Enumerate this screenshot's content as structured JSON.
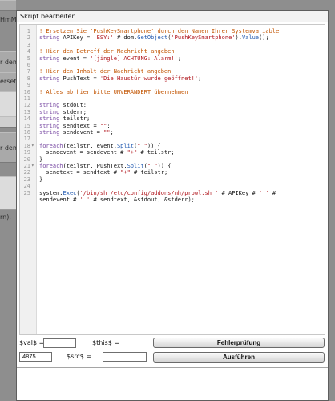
{
  "background": {
    "labels": [
      "HmM",
      "r dem",
      "ersetz",
      "r dem",
      "rn)."
    ]
  },
  "dialog": {
    "title": "Skript bearbeiten"
  },
  "editor": {
    "lines": [
      {
        "n": "1",
        "fold": "",
        "tokens": [
          {
            "t": "! Ersetzen Sie 'PushKeySmartphone' durch den Namen Ihrer Systemvariable",
            "c": "comment"
          }
        ]
      },
      {
        "n": "2",
        "fold": "",
        "tokens": [
          {
            "t": "string",
            "c": "keyword"
          },
          {
            "t": " APIKey = ",
            "c": "plain"
          },
          {
            "t": "'ESY:'",
            "c": "string"
          },
          {
            "t": " # dom.",
            "c": "plain"
          },
          {
            "t": "GetObject",
            "c": "func"
          },
          {
            "t": "(",
            "c": "plain"
          },
          {
            "t": "'PushKeySmartphone'",
            "c": "string"
          },
          {
            "t": ").",
            "c": "plain"
          },
          {
            "t": "Value",
            "c": "func"
          },
          {
            "t": "();",
            "c": "plain"
          }
        ]
      },
      {
        "n": "3",
        "fold": "",
        "tokens": []
      },
      {
        "n": "4",
        "fold": "",
        "tokens": [
          {
            "t": "! Hier den Betreff der Nachricht angeben",
            "c": "comment"
          }
        ]
      },
      {
        "n": "5",
        "fold": "",
        "tokens": [
          {
            "t": "string",
            "c": "keyword"
          },
          {
            "t": " event = ",
            "c": "plain"
          },
          {
            "t": "'[jingle] ACHTUNG: Alarm!'",
            "c": "string"
          },
          {
            "t": ";",
            "c": "plain"
          }
        ]
      },
      {
        "n": "6",
        "fold": "",
        "tokens": []
      },
      {
        "n": "7",
        "fold": "",
        "tokens": [
          {
            "t": "! Hier den Inhalt der Nachricht angeben",
            "c": "comment"
          }
        ]
      },
      {
        "n": "8",
        "fold": "",
        "tokens": [
          {
            "t": "string",
            "c": "keyword"
          },
          {
            "t": " PushText = ",
            "c": "plain"
          },
          {
            "t": "'Die Haustür wurde geöffnet!'",
            "c": "string"
          },
          {
            "t": ";",
            "c": "plain"
          }
        ]
      },
      {
        "n": "9",
        "fold": "",
        "tokens": []
      },
      {
        "n": "10",
        "fold": "",
        "tokens": [
          {
            "t": "! Alles ab hier bitte UNVERÄNDERT übernehmen",
            "c": "comment"
          }
        ]
      },
      {
        "n": "11",
        "fold": "",
        "tokens": []
      },
      {
        "n": "12",
        "fold": "",
        "tokens": [
          {
            "t": "string",
            "c": "keyword"
          },
          {
            "t": " stdout;",
            "c": "plain"
          }
        ]
      },
      {
        "n": "13",
        "fold": "",
        "tokens": [
          {
            "t": "string",
            "c": "keyword"
          },
          {
            "t": " stderr;",
            "c": "plain"
          }
        ]
      },
      {
        "n": "14",
        "fold": "",
        "tokens": [
          {
            "t": "string",
            "c": "keyword"
          },
          {
            "t": " teilstr;",
            "c": "plain"
          }
        ]
      },
      {
        "n": "15",
        "fold": "",
        "tokens": [
          {
            "t": "string",
            "c": "keyword"
          },
          {
            "t": " sendtext = ",
            "c": "plain"
          },
          {
            "t": "\"\"",
            "c": "string"
          },
          {
            "t": ";",
            "c": "plain"
          }
        ]
      },
      {
        "n": "16",
        "fold": "",
        "tokens": [
          {
            "t": "string",
            "c": "keyword"
          },
          {
            "t": " sendevent = ",
            "c": "plain"
          },
          {
            "t": "\"\"",
            "c": "string"
          },
          {
            "t": ";",
            "c": "plain"
          }
        ]
      },
      {
        "n": "17",
        "fold": "",
        "tokens": []
      },
      {
        "n": "18",
        "fold": "▾",
        "tokens": [
          {
            "t": "foreach",
            "c": "keyword"
          },
          {
            "t": "(teilstr, event.",
            "c": "plain"
          },
          {
            "t": "Split",
            "c": "func"
          },
          {
            "t": "(",
            "c": "plain"
          },
          {
            "t": "\" \"",
            "c": "string"
          },
          {
            "t": ")) {",
            "c": "plain"
          }
        ]
      },
      {
        "n": "19",
        "fold": "",
        "tokens": [
          {
            "t": "  sendevent = sendevent # ",
            "c": "plain"
          },
          {
            "t": "\"+\"",
            "c": "string"
          },
          {
            "t": " # teilstr;",
            "c": "plain"
          }
        ]
      },
      {
        "n": "20",
        "fold": "",
        "tokens": [
          {
            "t": "}",
            "c": "plain"
          }
        ]
      },
      {
        "n": "21",
        "fold": "▾",
        "tokens": [
          {
            "t": "foreach",
            "c": "keyword"
          },
          {
            "t": "(teilstr, PushText.",
            "c": "plain"
          },
          {
            "t": "Split",
            "c": "func"
          },
          {
            "t": "(",
            "c": "plain"
          },
          {
            "t": "\" \"",
            "c": "string"
          },
          {
            "t": ")) {",
            "c": "plain"
          }
        ]
      },
      {
        "n": "22",
        "fold": "",
        "tokens": [
          {
            "t": "  sendtext = sendtext # ",
            "c": "plain"
          },
          {
            "t": "\"+\"",
            "c": "string"
          },
          {
            "t": " # teilstr;",
            "c": "plain"
          }
        ]
      },
      {
        "n": "23",
        "fold": "",
        "tokens": [
          {
            "t": "}",
            "c": "plain"
          }
        ]
      },
      {
        "n": "24",
        "fold": "",
        "tokens": []
      },
      {
        "n": "25",
        "fold": "",
        "tokens": [
          {
            "t": "system.",
            "c": "plain"
          },
          {
            "t": "Exec",
            "c": "func"
          },
          {
            "t": "(",
            "c": "plain"
          },
          {
            "t": "'/bin/sh /etc/config/addons/mh/prowl.sh '",
            "c": "string"
          },
          {
            "t": " # APIKey # ",
            "c": "plain"
          },
          {
            "t": "' '",
            "c": "string"
          },
          {
            "t": " #",
            "c": "plain"
          }
        ]
      },
      {
        "n": "",
        "fold": "",
        "tokens": [
          {
            "t": "sendevent # ",
            "c": "plain"
          },
          {
            "t": "' '",
            "c": "string"
          },
          {
            "t": " # sendtext, &stdout, &stderr);",
            "c": "plain"
          }
        ]
      }
    ]
  },
  "controls": {
    "val_label": "$val$ =",
    "val_value": "",
    "this_label": "$this$ =",
    "check_button": "Fehlerprüfung",
    "number_value": "4875",
    "src_label": "$src$ =",
    "src_value": "",
    "run_button": "Ausführen"
  },
  "colors": {
    "comment": "#c25400",
    "keyword": "#7a4ca4",
    "string": "#b0141b",
    "function": "#1f58b0"
  }
}
